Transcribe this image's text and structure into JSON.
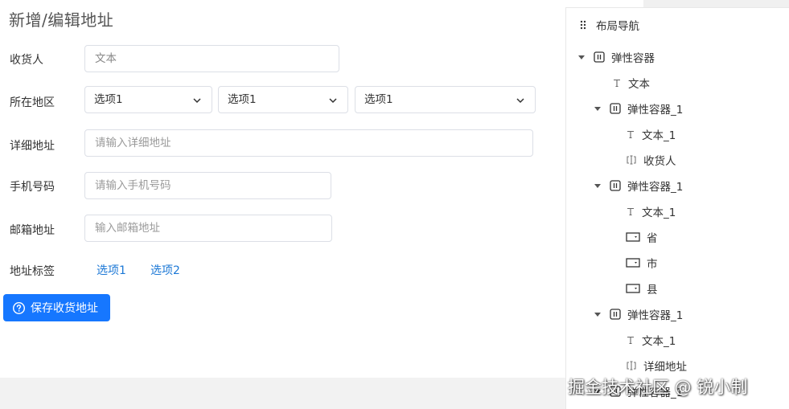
{
  "page": {
    "title": "新增/编辑地址"
  },
  "form": {
    "receiver": {
      "label": "收货人",
      "value": "文本"
    },
    "region": {
      "label": "所在地区",
      "selects": [
        "选项1",
        "选项1",
        "选项1"
      ]
    },
    "address": {
      "label": "详细地址",
      "placeholder": "请输入详细地址"
    },
    "phone": {
      "label": "手机号码",
      "placeholder": "请输入手机号码"
    },
    "email": {
      "label": "邮箱地址",
      "placeholder": "输入邮箱地址"
    },
    "tags": {
      "label": "地址标签",
      "options": [
        "选项1",
        "选项2"
      ]
    },
    "save_button": {
      "label": "保存收货地址",
      "icon": "question-circle-icon"
    }
  },
  "nav": {
    "title": "布局导航",
    "tree": [
      {
        "label": "弹性容器",
        "icon": "flex-container-icon",
        "expanded": true
      },
      {
        "label": "文本",
        "icon": "text-icon"
      },
      {
        "label": "弹性容器_1",
        "icon": "flex-container-icon",
        "expanded": true
      },
      {
        "label": "文本_1",
        "icon": "text-icon"
      },
      {
        "label": "收货人",
        "icon": "input-icon"
      },
      {
        "label": "弹性容器_1",
        "icon": "flex-container-icon",
        "expanded": true
      },
      {
        "label": "文本_1",
        "icon": "text-icon"
      },
      {
        "label": "省",
        "icon": "select-icon"
      },
      {
        "label": "市",
        "icon": "select-icon"
      },
      {
        "label": "县",
        "icon": "select-icon"
      },
      {
        "label": "弹性容器_1",
        "icon": "flex-container-icon",
        "expanded": true
      },
      {
        "label": "文本_1",
        "icon": "text-icon"
      },
      {
        "label": "详细地址",
        "icon": "input-icon"
      },
      {
        "label": "弹性容器_1",
        "icon": "flex-container-icon",
        "expanded": true
      }
    ]
  },
  "watermark": "掘金技术社区 @ 锐小制",
  "colors": {
    "primary": "#1677ff",
    "link": "#1c78d6",
    "border": "#dcdfe6"
  }
}
